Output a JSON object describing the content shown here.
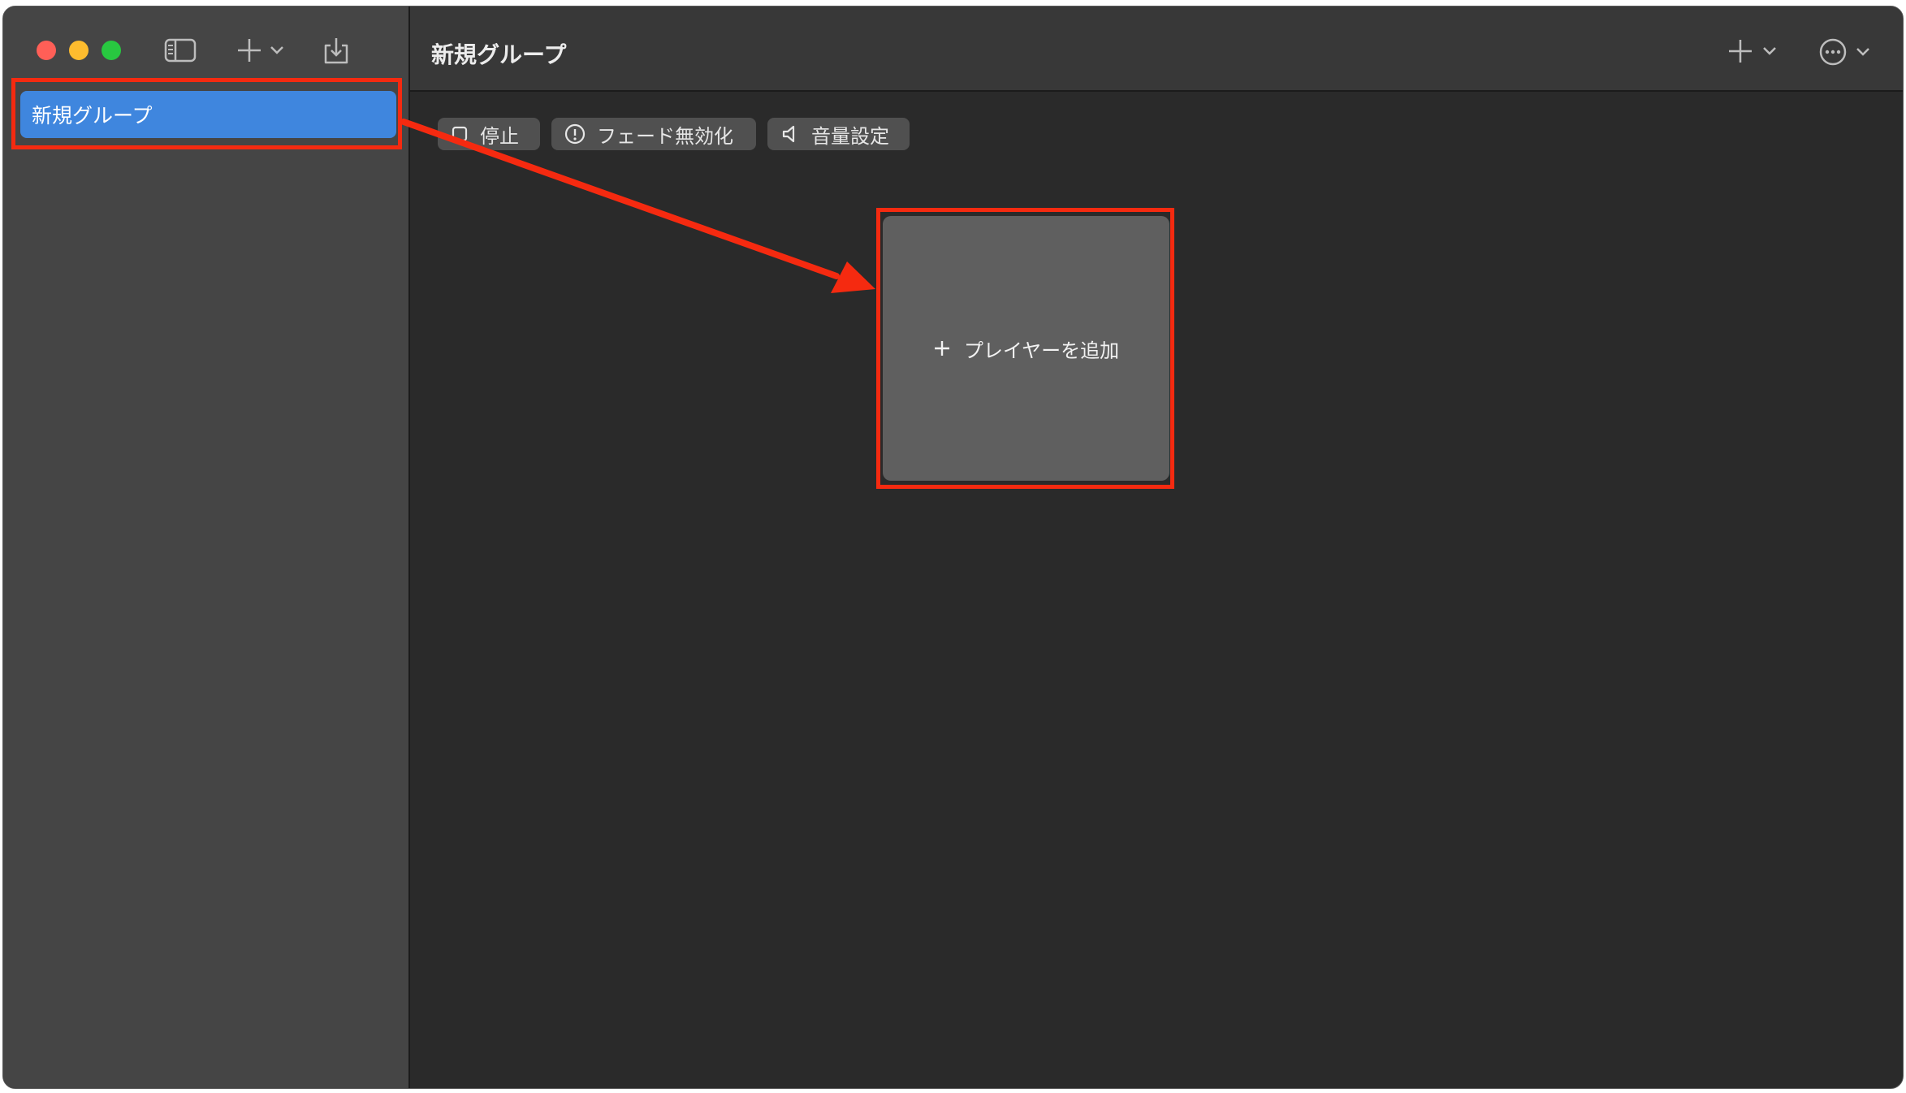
{
  "sidebar": {
    "groups": [
      {
        "label": "新規グループ",
        "selected": true
      }
    ]
  },
  "main": {
    "title": "新規グループ",
    "controls": {
      "stop_label": "停止",
      "fade_label": "フェード無効化",
      "volume_label": "音量設定"
    },
    "add_player_label": "プレイヤーを追加"
  },
  "colors": {
    "accent": "#3f86de",
    "annotation": "#f52a10",
    "traffic_close": "#ff5f57",
    "traffic_min": "#febc2e",
    "traffic_max": "#28c840"
  },
  "icons": {
    "sidebar_toggle": "sidebar-icon",
    "add": "plus-icon",
    "dropdown": "chevron-down-icon",
    "export": "tray-arrow-down-icon",
    "more": "ellipsis-circle-icon",
    "stop": "square-icon",
    "fade": "exclamation-circle-icon",
    "volume": "speaker-icon"
  }
}
